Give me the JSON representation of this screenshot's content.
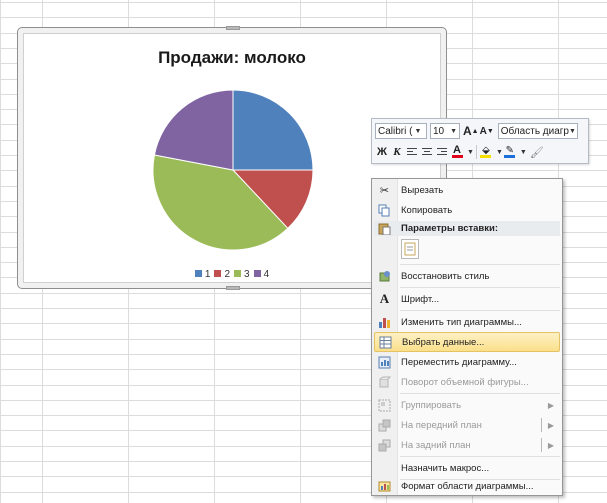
{
  "chart": {
    "title": "Продажи: молоко"
  },
  "chart_data": {
    "type": "pie",
    "title": "Продажи: молоко",
    "categories": [
      "1",
      "2",
      "3",
      "4"
    ],
    "values": [
      25,
      13,
      40,
      22
    ],
    "colors": [
      "#4f81bd",
      "#c0504d",
      "#9bbb59",
      "#8064a2"
    ],
    "legend_position": "bottom"
  },
  "mini_toolbar": {
    "font_name": "Calibri (",
    "font_size": "10",
    "grow_font": "A",
    "shrink_font": "A",
    "area_select": "Область диагр",
    "bold": "Ж",
    "italic": "К",
    "font_color_letter": "A"
  },
  "context_menu": {
    "items": [
      {
        "label": "Вырезать",
        "icon": "scissors-icon",
        "enabled": true
      },
      {
        "label": "Копировать",
        "icon": "copy-icon",
        "enabled": true
      },
      {
        "label": "Параметры вставки:",
        "icon": "paste-icon",
        "enabled": true
      },
      {
        "label": "Восстановить стиль",
        "icon": "reset-style-icon",
        "enabled": true
      },
      {
        "label": "Шрифт...",
        "icon": "font-icon",
        "enabled": true
      },
      {
        "label": "Изменить тип диаграммы...",
        "icon": "chart-type-icon",
        "enabled": true
      },
      {
        "label": "Выбрать данные...",
        "icon": "select-data-icon",
        "enabled": true,
        "highlighted": true
      },
      {
        "label": "Переместить диаграмму...",
        "icon": "move-chart-icon",
        "enabled": true
      },
      {
        "label": "Поворот объемной фигуры...",
        "icon": "rotation-3d-icon",
        "enabled": false
      },
      {
        "label": "Группировать",
        "icon": "group-icon",
        "enabled": false
      },
      {
        "label": "На передний план",
        "icon": "bring-front-icon",
        "enabled": false
      },
      {
        "label": "На задний план",
        "icon": "send-back-icon",
        "enabled": false
      },
      {
        "label": "Назначить макрос...",
        "icon": "",
        "enabled": true
      },
      {
        "label": "Формат области диаграммы...",
        "icon": "format-area-icon",
        "enabled": true
      }
    ]
  }
}
